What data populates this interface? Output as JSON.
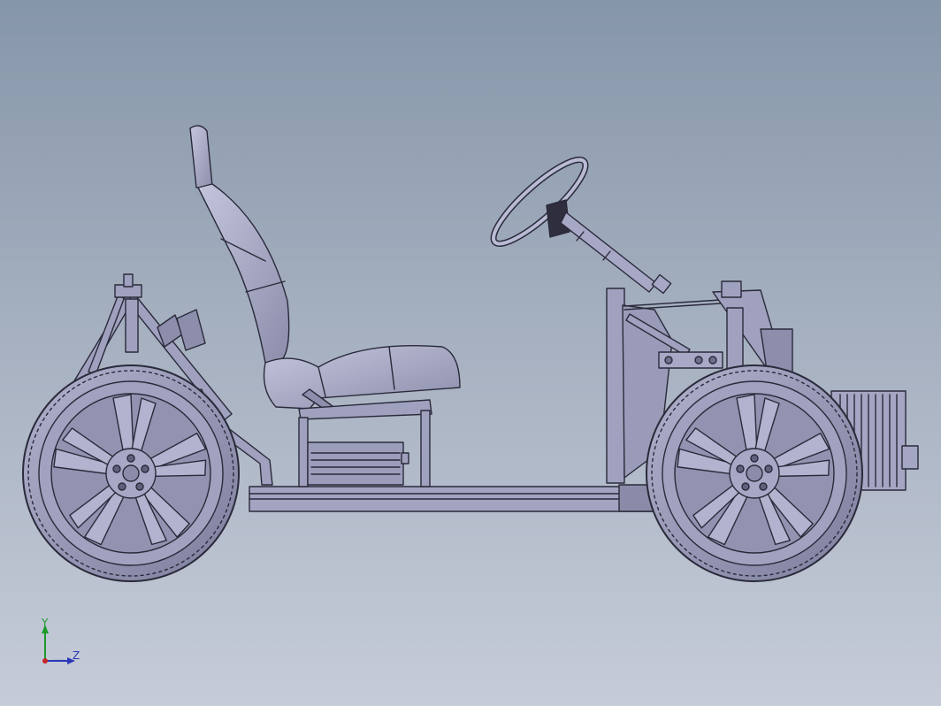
{
  "viewport": {
    "background_top": "#8696a9",
    "background_bottom": "#c6ccd8",
    "model": "go-kart-chassis-side-view",
    "part_color": "#9e9fbe",
    "edge_color": "#2a2a3a"
  },
  "triad": {
    "y_label": "Y",
    "z_label": "Z",
    "y_color": "#1c9a2a",
    "z_color": "#2a38b8",
    "origin_color": "#c62828"
  }
}
